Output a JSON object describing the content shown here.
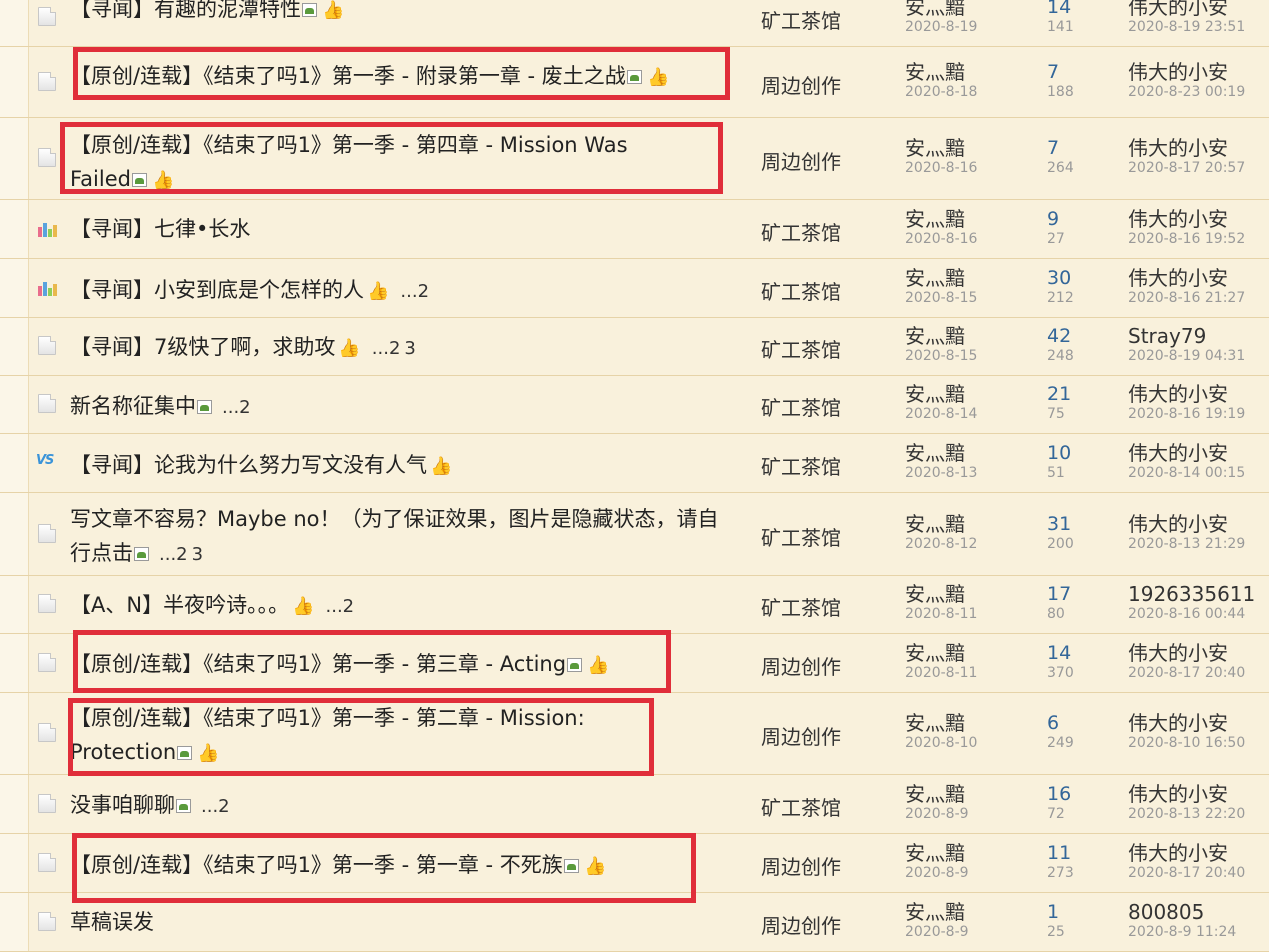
{
  "threads": [
    {
      "icon": "doc",
      "title": "【寻闻】有趣的泥潭特性",
      "img": true,
      "thumb": true,
      "pages": [],
      "forum": "矿工茶馆",
      "author": "安灬黯",
      "date": "2020-8-19",
      "replies": "14",
      "views": "141",
      "last_user": "伟大的小安",
      "last_time": "2020-8-19 23:51",
      "highlight": false
    },
    {
      "icon": "doc",
      "title": "【原创/连载】《结束了吗1》第一季 - 附录第一章 - 废土之战",
      "img": true,
      "thumb": true,
      "pages": [],
      "forum": "周边创作",
      "author": "安灬黯",
      "date": "2020-8-18",
      "replies": "7",
      "views": "188",
      "last_user": "伟大的小安",
      "last_time": "2020-8-23 00:19",
      "highlight": true
    },
    {
      "icon": "doc",
      "title": "【原创/连载】《结束了吗1》第一季 - 第四章 - Mission Was Failed",
      "img": true,
      "thumb": true,
      "pages": [],
      "forum": "周边创作",
      "author": "安灬黯",
      "date": "2020-8-16",
      "replies": "7",
      "views": "264",
      "last_user": "伟大的小安",
      "last_time": "2020-8-17 20:57",
      "highlight": true
    },
    {
      "icon": "poll",
      "title": "【寻闻】七律•长水",
      "img": false,
      "thumb": false,
      "pages": [],
      "forum": "矿工茶馆",
      "author": "安灬黯",
      "date": "2020-8-16",
      "replies": "9",
      "views": "27",
      "last_user": "伟大的小安",
      "last_time": "2020-8-16 19:52",
      "highlight": false
    },
    {
      "icon": "poll",
      "title": "【寻闻】小安到底是个怎样的人",
      "img": false,
      "thumb": true,
      "pages": [
        "2"
      ],
      "forum": "矿工茶馆",
      "author": "安灬黯",
      "date": "2020-8-15",
      "replies": "30",
      "views": "212",
      "last_user": "伟大的小安",
      "last_time": "2020-8-16 21:27",
      "highlight": false
    },
    {
      "icon": "doc",
      "title": "【寻闻】7级快了啊，求助攻",
      "img": false,
      "thumb": true,
      "pages": [
        "2",
        "3"
      ],
      "forum": "矿工茶馆",
      "author": "安灬黯",
      "date": "2020-8-15",
      "replies": "42",
      "views": "248",
      "last_user": "Stray79",
      "last_time": "2020-8-19 04:31",
      "highlight": false
    },
    {
      "icon": "doc",
      "title": "新名称征集中",
      "img": true,
      "thumb": false,
      "pages": [
        "2"
      ],
      "forum": "矿工茶馆",
      "author": "安灬黯",
      "date": "2020-8-14",
      "replies": "21",
      "views": "75",
      "last_user": "伟大的小安",
      "last_time": "2020-8-16 19:19",
      "highlight": false
    },
    {
      "icon": "vs",
      "title": "【寻闻】论我为什么努力写文没有人气",
      "img": false,
      "thumb": true,
      "pages": [],
      "forum": "矿工茶馆",
      "author": "安灬黯",
      "date": "2020-8-13",
      "replies": "10",
      "views": "51",
      "last_user": "伟大的小安",
      "last_time": "2020-8-14 00:15",
      "highlight": false
    },
    {
      "icon": "doc",
      "title": "写文章不容易？Maybe no！（为了保证效果，图片是隐藏状态，请自行点击",
      "img": true,
      "thumb": false,
      "pages": [
        "2",
        "3"
      ],
      "forum": "矿工茶馆",
      "author": "安灬黯",
      "date": "2020-8-12",
      "replies": "31",
      "views": "200",
      "last_user": "伟大的小安",
      "last_time": "2020-8-13 21:29",
      "highlight": false
    },
    {
      "icon": "doc",
      "title": "【A、N】半夜吟诗。。。",
      "img": false,
      "thumb": true,
      "pages": [
        "2"
      ],
      "forum": "矿工茶馆",
      "author": "安灬黯",
      "date": "2020-8-11",
      "replies": "17",
      "views": "80",
      "last_user": "1926335611",
      "last_time": "2020-8-16 00:44",
      "highlight": false
    },
    {
      "icon": "doc",
      "title": "【原创/连载】《结束了吗1》第一季 - 第三章 - Acting",
      "img": true,
      "thumb": true,
      "pages": [],
      "forum": "周边创作",
      "author": "安灬黯",
      "date": "2020-8-11",
      "replies": "14",
      "views": "370",
      "last_user": "伟大的小安",
      "last_time": "2020-8-17 20:40",
      "highlight": true
    },
    {
      "icon": "doc",
      "title": "【原创/连载】《结束了吗1》第一季 - 第二章 - Mission: Protection",
      "img": true,
      "thumb": true,
      "pages": [],
      "forum": "周边创作",
      "author": "安灬黯",
      "date": "2020-8-10",
      "replies": "6",
      "views": "249",
      "last_user": "伟大的小安",
      "last_time": "2020-8-10 16:50",
      "highlight": true
    },
    {
      "icon": "doc",
      "title": "没事咱聊聊",
      "img": true,
      "thumb": false,
      "pages": [
        "2"
      ],
      "forum": "矿工茶馆",
      "author": "安灬黯",
      "date": "2020-8-9",
      "replies": "16",
      "views": "72",
      "last_user": "伟大的小安",
      "last_time": "2020-8-13 22:20",
      "highlight": false
    },
    {
      "icon": "doc",
      "title": "【原创/连载】《结束了吗1》第一季 - 第一章 - 不死族",
      "img": true,
      "thumb": true,
      "pages": [],
      "forum": "周边创作",
      "author": "安灬黯",
      "date": "2020-8-9",
      "replies": "11",
      "views": "273",
      "last_user": "伟大的小安",
      "last_time": "2020-8-17 20:40",
      "highlight": true
    },
    {
      "icon": "doc",
      "title": "草稿误发",
      "img": false,
      "thumb": false,
      "pages": [],
      "forum": "周边创作",
      "author": "安灬黯",
      "date": "2020-8-9",
      "replies": "1",
      "views": "25",
      "last_user": "800805",
      "last_time": "2020-8-9 11:24",
      "highlight": false
    }
  ],
  "ellipsis": "...",
  "colors": {
    "highlight": "#e02e3a",
    "background": "#f9f1dc",
    "link": "#336699"
  }
}
